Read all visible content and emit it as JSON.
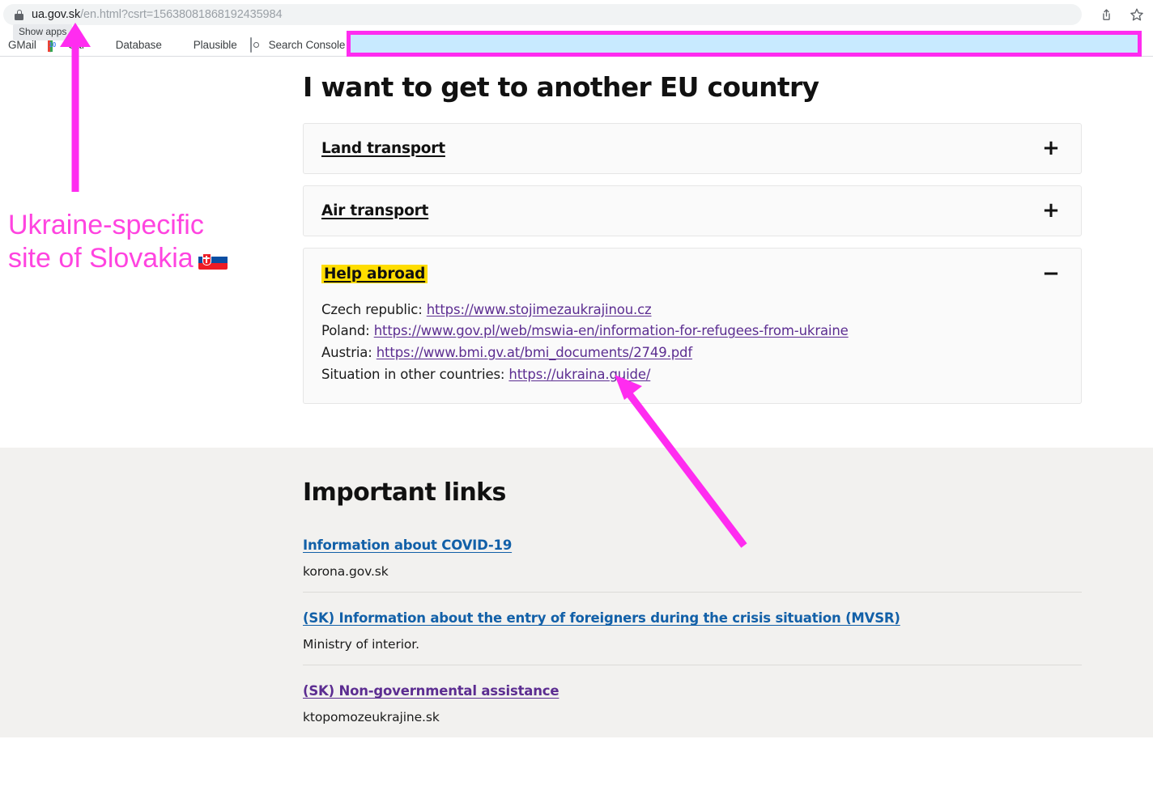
{
  "browser": {
    "url_domain": "ua.gov.sk",
    "url_path": "/en.html?csrt=15638081868192435984",
    "lock_icon": "lock-icon",
    "share_icon": "share-icon",
    "bookmark_star_icon": "star-icon",
    "tooltip": "Show apps",
    "bookmarks": [
      {
        "label": "GMail",
        "icon": "none"
      },
      {
        "label": "Cal",
        "icon": "calendar-icon",
        "badge": "10"
      },
      {
        "label": "Database",
        "icon": "database-icon"
      },
      {
        "label": "Plausible",
        "icon": "speech-bubble-icon"
      },
      {
        "label": "Search Console",
        "icon": "search-console-icon"
      }
    ]
  },
  "main": {
    "page_title": "I want to get to another EU country",
    "accordion": [
      {
        "title": "Land transport",
        "toggle": "+",
        "expanded": false,
        "highlighted": false
      },
      {
        "title": "Air transport",
        "toggle": "+",
        "expanded": false,
        "highlighted": false
      },
      {
        "title": "Help abroad",
        "toggle": "−",
        "expanded": true,
        "highlighted": true,
        "lines": [
          {
            "prefix": "Czech republic: ",
            "link": "https://www.stojimezaukrajinou.cz"
          },
          {
            "prefix": "Poland: ",
            "link": "https://www.gov.pl/web/mswia-en/information-for-refugees-from-ukraine"
          },
          {
            "prefix": "Austria: ",
            "link": "https://www.bmi.gv.at/bmi_documents/2749.pdf"
          },
          {
            "prefix": "Situation in other countries: ",
            "link": "https://ukraina.guide/"
          }
        ]
      }
    ]
  },
  "important_links": {
    "heading": "Important links",
    "entries": [
      {
        "title": "Information about COVID-19",
        "desc": "korona.gov.sk",
        "state": "blue"
      },
      {
        "title": "(SK) Information about the entry of foreigners during the crisis situation (MVSR)",
        "desc": "Ministry of interior.",
        "state": "blue"
      },
      {
        "title": "(SK) Non-governmental assistance",
        "desc": "ktopomozeukrajine.sk",
        "state": "purple"
      }
    ]
  },
  "annotations": {
    "callout_line1": "Ukraine-specific",
    "callout_line2": "site of Slovakia",
    "flag": "slovakia-flag-emoji",
    "color": "#ff44e0",
    "redaction_fill": "#c8eaff",
    "redaction_border": "#ff2cf0"
  }
}
